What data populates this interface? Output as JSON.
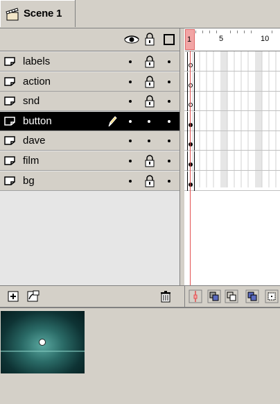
{
  "scene": {
    "label": "Scene 1"
  },
  "timeline": {
    "ruler_labels": [
      "1",
      "5",
      "10"
    ],
    "layers": [
      {
        "name": "labels",
        "locked": true,
        "selected": false,
        "keyframe": "empty"
      },
      {
        "name": "action",
        "locked": true,
        "selected": false,
        "keyframe": "empty"
      },
      {
        "name": "snd",
        "locked": true,
        "selected": false,
        "keyframe": "empty"
      },
      {
        "name": "button",
        "locked": false,
        "selected": true,
        "keyframe": "full"
      },
      {
        "name": "dave",
        "locked": false,
        "selected": false,
        "keyframe": "full"
      },
      {
        "name": "film",
        "locked": true,
        "selected": false,
        "keyframe": "full"
      },
      {
        "name": "bg",
        "locked": true,
        "selected": false,
        "keyframe": "full"
      }
    ]
  },
  "colors": {
    "selected_row": "#000000",
    "playhead": "#e25050",
    "panel_bg": "#d4d0c8"
  },
  "icons": {
    "header": [
      "eye-icon",
      "lock-icon",
      "outline-icon"
    ],
    "toolbar_left": [
      "insert-layer-icon",
      "add-motion-guide-icon",
      "delete-layer-icon"
    ],
    "toolbar_right": [
      "center-frame-icon",
      "onion-skin-icon",
      "onion-skin-outlines-icon",
      "edit-multiple-frames-icon",
      "modify-onion-markers-icon"
    ]
  }
}
